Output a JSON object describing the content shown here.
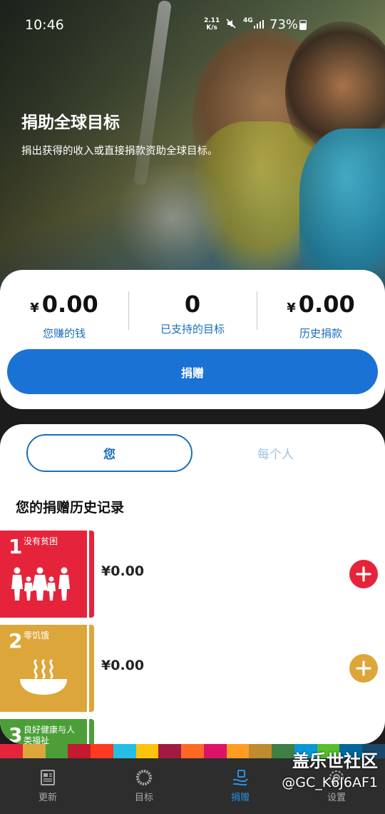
{
  "status_bar": {
    "time": "10:46",
    "speed_value": "2.11",
    "speed_unit": "K/s",
    "network": "4G",
    "battery": "73%"
  },
  "hero": {
    "title": "捐助全球目标",
    "subtitle": "捐出获得的收入或直接捐款资助全球目标。"
  },
  "stats": [
    {
      "currency": "¥",
      "value": "0.00",
      "label": "您赚的钱"
    },
    {
      "currency": "",
      "value": "0",
      "label": "已支持的目标"
    },
    {
      "currency": "¥",
      "value": "0.00",
      "label": "历史捐款"
    }
  ],
  "donate_label": "捐赠",
  "segments": {
    "you": "您",
    "everyone": "每个人"
  },
  "history_title": "您的捐赠历史记录",
  "goals": [
    {
      "number": "1",
      "name": "没有贫困",
      "amount": "¥0.00",
      "color": "#e5243b"
    },
    {
      "number": "2",
      "name": "零饥饿",
      "amount": "¥0.00",
      "color": "#dda63a"
    },
    {
      "number": "3",
      "name": "良好健康与人类福祉",
      "amount": "",
      "color": "#4c9f38"
    }
  ],
  "sdg_colors": [
    "#e5243b",
    "#dda63a",
    "#4c9f38",
    "#c5192d",
    "#ff3a21",
    "#26bde2",
    "#fcc30b",
    "#a21942",
    "#fd6925",
    "#dd1367",
    "#fd9d24",
    "#bf8b2e",
    "#3f7e44",
    "#0a97d9",
    "#56c02b",
    "#00689d",
    "#19486a"
  ],
  "nav": [
    {
      "label": "更新",
      "icon": "newspaper-icon",
      "active": false
    },
    {
      "label": "目标",
      "icon": "goals-wheel-icon",
      "active": false
    },
    {
      "label": "捐赠",
      "icon": "donate-hand-icon",
      "active": true
    },
    {
      "label": "设置",
      "icon": "settings-icon",
      "active": false
    }
  ],
  "watermark": {
    "line1": "盖乐世社区",
    "line2": "@GC_K6J6AF1"
  }
}
